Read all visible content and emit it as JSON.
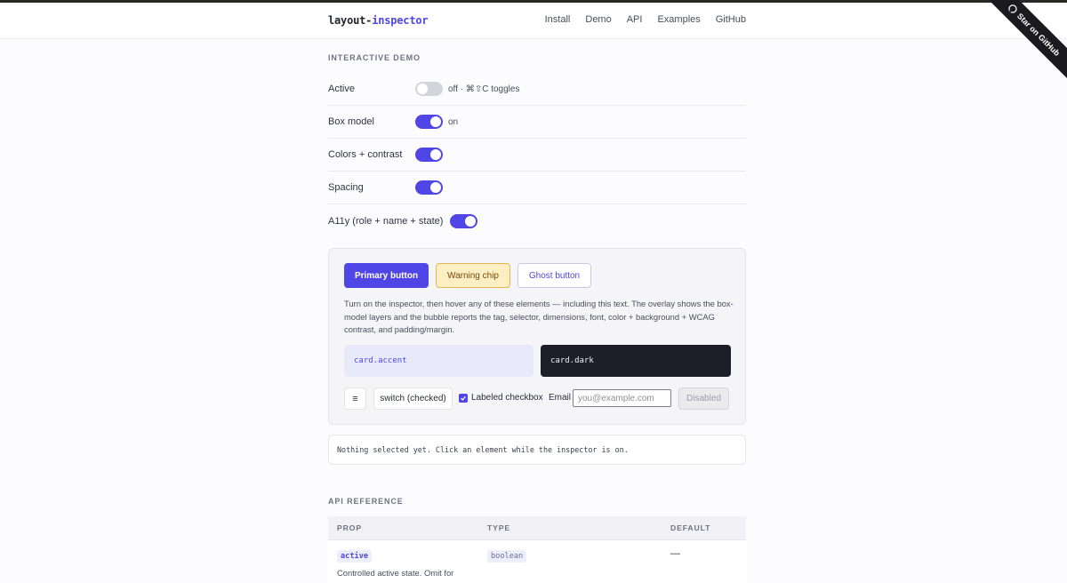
{
  "header": {
    "logo_prefix": "layout-",
    "logo_accent": "inspector",
    "nav": [
      "Install",
      "Demo",
      "API",
      "Examples",
      "GitHub"
    ],
    "ribbon": "Star on GitHub"
  },
  "demo": {
    "section_title": "INTERACTIVE DEMO",
    "rows": [
      {
        "label": "Active",
        "on": false,
        "text": "off · ⌘⇧C toggles"
      },
      {
        "label": "Box model",
        "on": true,
        "text": "on"
      },
      {
        "label": "Colors + contrast",
        "on": true,
        "text": ""
      },
      {
        "label": "Spacing",
        "on": true,
        "text": ""
      },
      {
        "label": "A11y (role + name + state)",
        "on": true,
        "text": ""
      }
    ],
    "primary_button": "Primary button",
    "warning_chip": "Warning chip",
    "ghost_button": "Ghost button",
    "description": "Turn on the inspector, then hover any of these elements — including this text. The overlay shows the box-model layers and the bubble reports the tag, selector, dimensions, font, color + background + WCAG contrast, and padding/margin.",
    "card_accent": "card.accent",
    "card_dark": "card.dark",
    "menu_icon": "≡",
    "switch_button": "switch (checked)",
    "checkbox_label": "Labeled checkbox",
    "email_label": "Email",
    "email_placeholder": "you@example.com",
    "disabled_button": "Disabled",
    "selection_status": "Nothing selected yet. Click an element while the inspector is on."
  },
  "api": {
    "section_title": "API REFERENCE",
    "headers": [
      "PROP",
      "TYPE",
      "DEFAULT"
    ],
    "rows": [
      {
        "prop": "active",
        "type": "boolean",
        "default": "—",
        "description": "Controlled active state. Omit for"
      }
    ]
  },
  "colors": {
    "accent": "#4f46e5",
    "dark_card": "#1c1e2a",
    "warning_bg": "#fcefc4"
  }
}
